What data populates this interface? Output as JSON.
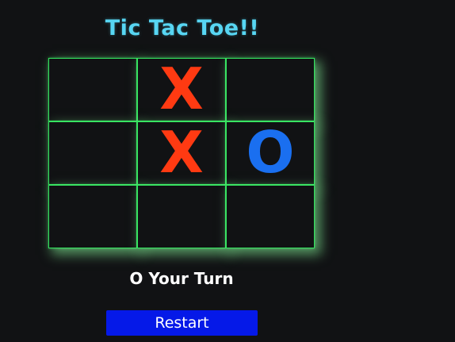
{
  "title": "Tic Tac Toe!!",
  "board": {
    "cells": [
      "",
      "X",
      "",
      "",
      "X",
      "O",
      "",
      "",
      ""
    ]
  },
  "status": "O Your Turn",
  "restart_label": "Restart",
  "colors": {
    "background": "#111214",
    "title": "#57d6f3",
    "grid": "#33e35e",
    "x_mark": "#ff3a12",
    "o_mark": "#1a6ff0",
    "button": "#0519e8"
  }
}
